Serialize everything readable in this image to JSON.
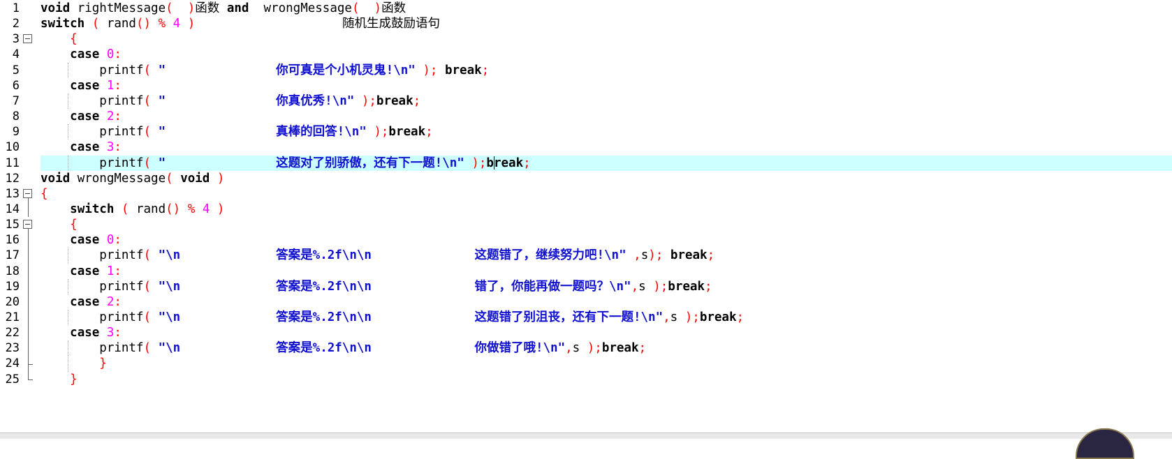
{
  "editor": {
    "lines": [
      {
        "num": "1",
        "segments": [
          {
            "t": "void",
            "c": "kw"
          },
          {
            "t": " rightMessage",
            "c": "plain"
          },
          {
            "t": "(  )",
            "c": "op"
          },
          {
            "t": "函数 ",
            "c": "plain"
          },
          {
            "t": "and",
            "c": "kw"
          },
          {
            "t": "  wrongMessage",
            "c": "plain"
          },
          {
            "t": "(  )",
            "c": "op"
          },
          {
            "t": "函数",
            "c": "plain"
          }
        ]
      },
      {
        "num": "2",
        "segments": [
          {
            "t": "switch",
            "c": "kw"
          },
          {
            "t": " ( ",
            "c": "op"
          },
          {
            "t": "rand",
            "c": "plain"
          },
          {
            "t": "() % ",
            "c": "op"
          },
          {
            "t": "4",
            "c": "num"
          },
          {
            "t": " )",
            "c": "op"
          },
          {
            "t": "                    随机生成鼓励语句",
            "c": "plain"
          }
        ]
      },
      {
        "num": "3",
        "segments": [
          {
            "t": "    {",
            "c": "op"
          }
        ]
      },
      {
        "num": "4",
        "segments": [
          {
            "t": "    ",
            "c": "plain"
          },
          {
            "t": "case",
            "c": "kw"
          },
          {
            "t": " 0",
            "c": "num"
          },
          {
            "t": ":",
            "c": "op"
          }
        ]
      },
      {
        "num": "5",
        "segments": [
          {
            "t": "        printf",
            "c": "plain"
          },
          {
            "t": "( ",
            "c": "op"
          },
          {
            "t": "\"               你可真是个小机灵鬼!\\n\"",
            "c": "str"
          },
          {
            "t": " ); ",
            "c": "op"
          },
          {
            "t": "break",
            "c": "kw"
          },
          {
            "t": ";",
            "c": "op"
          }
        ]
      },
      {
        "num": "6",
        "segments": [
          {
            "t": "    ",
            "c": "plain"
          },
          {
            "t": "case",
            "c": "kw"
          },
          {
            "t": " 1",
            "c": "num"
          },
          {
            "t": ":",
            "c": "op"
          }
        ]
      },
      {
        "num": "7",
        "segments": [
          {
            "t": "        printf",
            "c": "plain"
          },
          {
            "t": "( ",
            "c": "op"
          },
          {
            "t": "\"               你真优秀!\\n\"",
            "c": "str"
          },
          {
            "t": " );",
            "c": "op"
          },
          {
            "t": "break",
            "c": "kw"
          },
          {
            "t": ";",
            "c": "op"
          }
        ]
      },
      {
        "num": "8",
        "segments": [
          {
            "t": "    ",
            "c": "plain"
          },
          {
            "t": "case",
            "c": "kw"
          },
          {
            "t": " 2",
            "c": "num"
          },
          {
            "t": ":",
            "c": "op"
          }
        ]
      },
      {
        "num": "9",
        "segments": [
          {
            "t": "        printf",
            "c": "plain"
          },
          {
            "t": "( ",
            "c": "op"
          },
          {
            "t": "\"               真棒的回答!\\n\"",
            "c": "str"
          },
          {
            "t": " );",
            "c": "op"
          },
          {
            "t": "break",
            "c": "kw"
          },
          {
            "t": ";",
            "c": "op"
          }
        ]
      },
      {
        "num": "10",
        "segments": [
          {
            "t": "    ",
            "c": "plain"
          },
          {
            "t": "case",
            "c": "kw"
          },
          {
            "t": " 3",
            "c": "num"
          },
          {
            "t": ":",
            "c": "op"
          }
        ]
      },
      {
        "num": "11",
        "current": true,
        "segments": [
          {
            "t": "        printf",
            "c": "plain"
          },
          {
            "t": "( ",
            "c": "op"
          },
          {
            "t": "\"               这题对了别骄傲，还有下一题!\\n\"",
            "c": "str"
          },
          {
            "t": " );",
            "c": "op"
          },
          {
            "t": "b",
            "c": "kw"
          },
          {
            "t": "",
            "c": "cursor"
          },
          {
            "t": "reak",
            "c": "kw"
          },
          {
            "t": ";",
            "c": "op"
          }
        ]
      },
      {
        "num": "12",
        "segments": [
          {
            "t": "void",
            "c": "kw"
          },
          {
            "t": " wrongMessage",
            "c": "plain"
          },
          {
            "t": "( ",
            "c": "op"
          },
          {
            "t": "void",
            "c": "kw"
          },
          {
            "t": " )",
            "c": "op"
          }
        ]
      },
      {
        "num": "13",
        "segments": [
          {
            "t": "{",
            "c": "op"
          }
        ]
      },
      {
        "num": "14",
        "segments": [
          {
            "t": "    ",
            "c": "plain"
          },
          {
            "t": "switch",
            "c": "kw"
          },
          {
            "t": " ( ",
            "c": "op"
          },
          {
            "t": "rand",
            "c": "plain"
          },
          {
            "t": "() % ",
            "c": "op"
          },
          {
            "t": "4",
            "c": "num"
          },
          {
            "t": " )",
            "c": "op"
          }
        ]
      },
      {
        "num": "15",
        "segments": [
          {
            "t": "    {",
            "c": "op"
          }
        ]
      },
      {
        "num": "16",
        "segments": [
          {
            "t": "    ",
            "c": "plain"
          },
          {
            "t": "case",
            "c": "kw"
          },
          {
            "t": " 0",
            "c": "num"
          },
          {
            "t": ":",
            "c": "op"
          }
        ]
      },
      {
        "num": "17",
        "segments": [
          {
            "t": "        printf",
            "c": "plain"
          },
          {
            "t": "( ",
            "c": "op"
          },
          {
            "t": "\"\\n             答案是%.2f\\n\\n              这题错了，继续努力吧!\\n\"",
            "c": "str"
          },
          {
            "t": " ,",
            "c": "op"
          },
          {
            "t": "s",
            "c": "plain"
          },
          {
            "t": "); ",
            "c": "op"
          },
          {
            "t": "break",
            "c": "kw"
          },
          {
            "t": ";",
            "c": "op"
          }
        ]
      },
      {
        "num": "18",
        "segments": [
          {
            "t": "    ",
            "c": "plain"
          },
          {
            "t": "case",
            "c": "kw"
          },
          {
            "t": " 1",
            "c": "num"
          },
          {
            "t": ":",
            "c": "op"
          }
        ]
      },
      {
        "num": "19",
        "segments": [
          {
            "t": "        printf",
            "c": "plain"
          },
          {
            "t": "( ",
            "c": "op"
          },
          {
            "t": "\"\\n             答案是%.2f\\n\\n              错了，你能再做一题吗？\\n\"",
            "c": "str"
          },
          {
            "t": ",",
            "c": "op"
          },
          {
            "t": "s",
            "c": "plain"
          },
          {
            "t": " );",
            "c": "op"
          },
          {
            "t": "break",
            "c": "kw"
          },
          {
            "t": ";",
            "c": "op"
          }
        ]
      },
      {
        "num": "20",
        "segments": [
          {
            "t": "    ",
            "c": "plain"
          },
          {
            "t": "case",
            "c": "kw"
          },
          {
            "t": " 2",
            "c": "num"
          },
          {
            "t": ":",
            "c": "op"
          }
        ]
      },
      {
        "num": "21",
        "segments": [
          {
            "t": "        printf",
            "c": "plain"
          },
          {
            "t": "( ",
            "c": "op"
          },
          {
            "t": "\"\\n             答案是%.2f\\n\\n              这题错了别沮丧，还有下一题!\\n\"",
            "c": "str"
          },
          {
            "t": ",",
            "c": "op"
          },
          {
            "t": "s",
            "c": "plain"
          },
          {
            "t": " );",
            "c": "op"
          },
          {
            "t": "break",
            "c": "kw"
          },
          {
            "t": ";",
            "c": "op"
          }
        ]
      },
      {
        "num": "22",
        "segments": [
          {
            "t": "    ",
            "c": "plain"
          },
          {
            "t": "case",
            "c": "kw"
          },
          {
            "t": " 3",
            "c": "num"
          },
          {
            "t": ":",
            "c": "op"
          }
        ]
      },
      {
        "num": "23",
        "segments": [
          {
            "t": "        printf",
            "c": "plain"
          },
          {
            "t": "( ",
            "c": "op"
          },
          {
            "t": "\"\\n             答案是%.2f\\n\\n              你做错了哦!\\n\"",
            "c": "str"
          },
          {
            "t": ",",
            "c": "op"
          },
          {
            "t": "s",
            "c": "plain"
          },
          {
            "t": " );",
            "c": "op"
          },
          {
            "t": "break",
            "c": "kw"
          },
          {
            "t": ";",
            "c": "op"
          }
        ]
      },
      {
        "num": "24",
        "segments": [
          {
            "t": "        }",
            "c": "op"
          }
        ]
      },
      {
        "num": "25",
        "segments": [
          {
            "t": "    }",
            "c": "op"
          }
        ]
      }
    ]
  },
  "colors": {
    "current_line": "#ccffff",
    "keyword": "#000000",
    "operator": "#ff0000",
    "number": "#ff00ff",
    "string": "#1010d0"
  }
}
